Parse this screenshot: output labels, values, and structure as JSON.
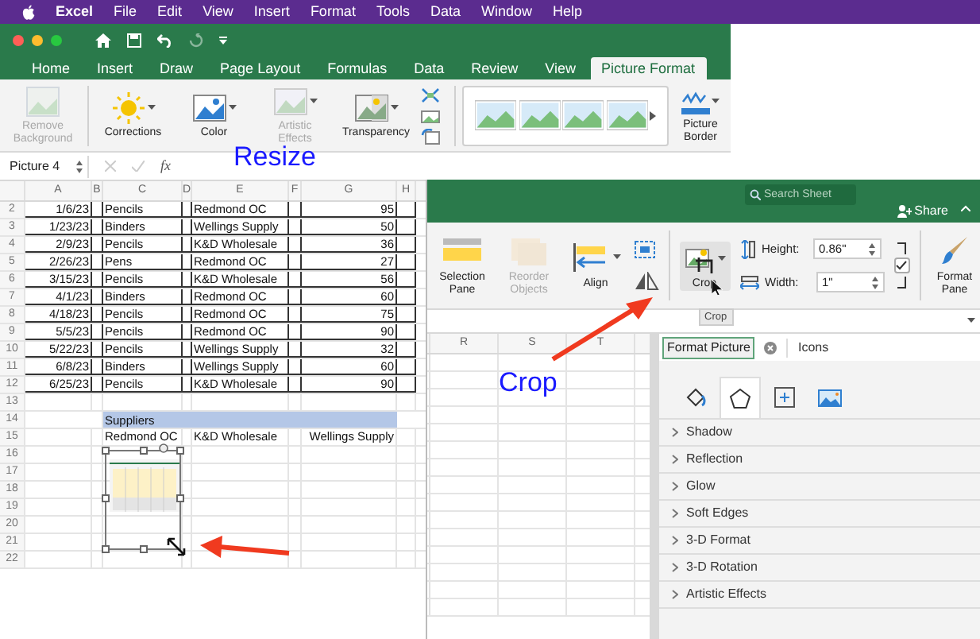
{
  "menu_bar": {
    "app": "Excel",
    "items": [
      "File",
      "Edit",
      "View",
      "Insert",
      "Format",
      "Tools",
      "Data",
      "Window",
      "Help"
    ]
  },
  "excel_window": {
    "redo": {
      "disabled": true
    },
    "tabs": [
      {
        "label": "Home",
        "selected": false
      },
      {
        "label": "Insert",
        "selected": false
      },
      {
        "label": "Draw",
        "selected": false
      },
      {
        "label": "Page Layout",
        "selected": false
      },
      {
        "label": "Formulas",
        "selected": false
      },
      {
        "label": "Data",
        "selected": false
      },
      {
        "label": "Review",
        "selected": false
      },
      {
        "label": "View",
        "selected": false
      },
      {
        "label": "Picture Format",
        "selected": true
      }
    ],
    "ribbon": [
      {
        "label": "Remove Background",
        "kind": "remove",
        "disabled": true
      },
      {
        "label": "Corrections",
        "kind": "corrections",
        "disabled": false
      },
      {
        "label": "Color",
        "kind": "color",
        "disabled": false
      },
      {
        "label": "Artistic Effects",
        "kind": "artistic",
        "disabled": true
      },
      {
        "label": "Transparency",
        "kind": "transparency",
        "disabled": false
      }
    ],
    "border_button": "Picture Border",
    "name_box": "Picture 4",
    "function_label": "fx",
    "sheet": {
      "columns": [
        "A",
        "B",
        "C",
        "D",
        "E",
        "F",
        "G",
        "H"
      ],
      "rows": [
        {
          "number": "2",
          "kind": "data",
          "cells": [
            "1/6/23",
            "",
            "Pencils",
            "",
            "Redmond OC",
            "",
            "95"
          ]
        },
        {
          "number": "3",
          "kind": "data",
          "cells": [
            "1/23/23",
            "",
            "Binders",
            "",
            "Wellings Supply",
            "",
            "50"
          ]
        },
        {
          "number": "4",
          "kind": "data",
          "cells": [
            "2/9/23",
            "",
            "Pencils",
            "",
            "K&D Wholesale",
            "",
            "36"
          ]
        },
        {
          "number": "5",
          "kind": "data",
          "cells": [
            "2/26/23",
            "",
            "Pens",
            "",
            "Redmond OC",
            "",
            "27"
          ]
        },
        {
          "number": "6",
          "kind": "data",
          "cells": [
            "3/15/23",
            "",
            "Pencils",
            "",
            "K&D Wholesale",
            "",
            "56"
          ]
        },
        {
          "number": "7",
          "kind": "data",
          "cells": [
            "4/1/23",
            "",
            "Binders",
            "",
            "Redmond OC",
            "",
            "60"
          ]
        },
        {
          "number": "8",
          "kind": "data",
          "cells": [
            "4/18/23",
            "",
            "Pencils",
            "",
            "Redmond OC",
            "",
            "75"
          ]
        },
        {
          "number": "9",
          "kind": "data",
          "cells": [
            "5/5/23",
            "",
            "Pencils",
            "",
            "Redmond OC",
            "",
            "90"
          ]
        },
        {
          "number": "10",
          "kind": "data",
          "cells": [
            "5/22/23",
            "",
            "Pencils",
            "",
            "Wellings Supply",
            "",
            "32"
          ]
        },
        {
          "number": "11",
          "kind": "data",
          "cells": [
            "6/8/23",
            "",
            "Binders",
            "",
            "Wellings Supply",
            "",
            "60"
          ]
        },
        {
          "number": "12",
          "kind": "data",
          "cells": [
            "6/25/23",
            "",
            "Pencils",
            "",
            "K&D Wholesale",
            "",
            "90"
          ]
        },
        {
          "number": "13",
          "kind": "plain"
        },
        {
          "number": "14",
          "kind": "band",
          "cells": [
            "",
            "",
            "Suppliers"
          ]
        },
        {
          "number": "15",
          "kind": "plain",
          "cells": [
            "",
            "",
            "Redmond OC",
            "",
            "K&D Wholesale",
            "",
            "Wellings Supply"
          ]
        },
        {
          "number": "16",
          "kind": "plain"
        },
        {
          "number": "17",
          "kind": "plain"
        },
        {
          "number": "18",
          "kind": "plain"
        },
        {
          "number": "19",
          "kind": "plain"
        },
        {
          "number": "20",
          "kind": "plain"
        },
        {
          "number": "21",
          "kind": "plain"
        },
        {
          "number": "22",
          "kind": "plain"
        }
      ]
    }
  },
  "second_window": {
    "search": {
      "placeholder": "Search Sheet"
    },
    "share": "Share",
    "ribbon": [
      {
        "label": "Selection Pane",
        "kind": "selection",
        "disabled": false
      },
      {
        "label": "Reorder Objects",
        "kind": "reorder",
        "disabled": true
      },
      {
        "label": "Align",
        "kind": "align",
        "disabled": false
      }
    ],
    "crop": {
      "label": "Crop",
      "tooltip": "Crop"
    },
    "size_fields": [
      {
        "label": "Height:",
        "value": "0.86\""
      },
      {
        "label": "Width:",
        "value": "1\""
      }
    ],
    "lock_aspect": {
      "checked": true
    },
    "format_pane": "Format Pane",
    "sheet": {
      "columns": [
        "R",
        "S",
        "T"
      ]
    },
    "panel": {
      "tabs": [
        {
          "label": "Format Picture",
          "selected": true
        },
        {
          "label": "Icons",
          "selected": false
        }
      ],
      "icon_tabs": [
        {
          "kind": "fill",
          "selected": false
        },
        {
          "kind": "shape",
          "selected": true
        },
        {
          "kind": "size",
          "selected": false
        },
        {
          "kind": "picture",
          "selected": false
        }
      ],
      "sections": [
        {
          "label": "Shadow",
          "expanded": false
        },
        {
          "label": "Reflection",
          "expanded": false
        },
        {
          "label": "Glow",
          "expanded": false
        },
        {
          "label": "Soft Edges",
          "expanded": false
        },
        {
          "label": "3-D Format",
          "expanded": false
        },
        {
          "label": "3-D Rotation",
          "expanded": false
        },
        {
          "label": "Artistic Effects",
          "expanded": false
        }
      ]
    }
  },
  "annotations": [
    {
      "text": "Resize"
    },
    {
      "text": "Crop"
    }
  ]
}
